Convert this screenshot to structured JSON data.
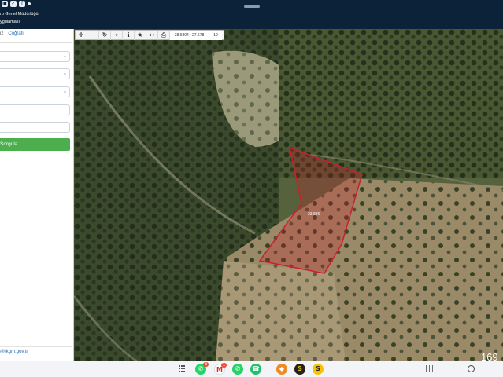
{
  "header": {
    "title_line1": "ro Genel Müdürlüğü",
    "title_line2": "ygulaması"
  },
  "left_panel": {
    "tabs": [
      "iz",
      "Coğrafi"
    ],
    "query_button": "Sorgula",
    "footer_email": "@tkgm.gov.tr"
  },
  "map": {
    "toolbar": {
      "coordinates": "38.9804 : 27.678",
      "zoom": "19"
    },
    "parcel": {
      "label": "23.886",
      "outline_color": "#cc1f2e"
    }
  },
  "system": {
    "clock": "169",
    "notification_badges": {
      "whatsapp1": "8",
      "gmail": "1"
    }
  },
  "colors": {
    "header_bg": "#0c2238",
    "query_button": "#4cae4c",
    "link": "#2b6cb0"
  }
}
